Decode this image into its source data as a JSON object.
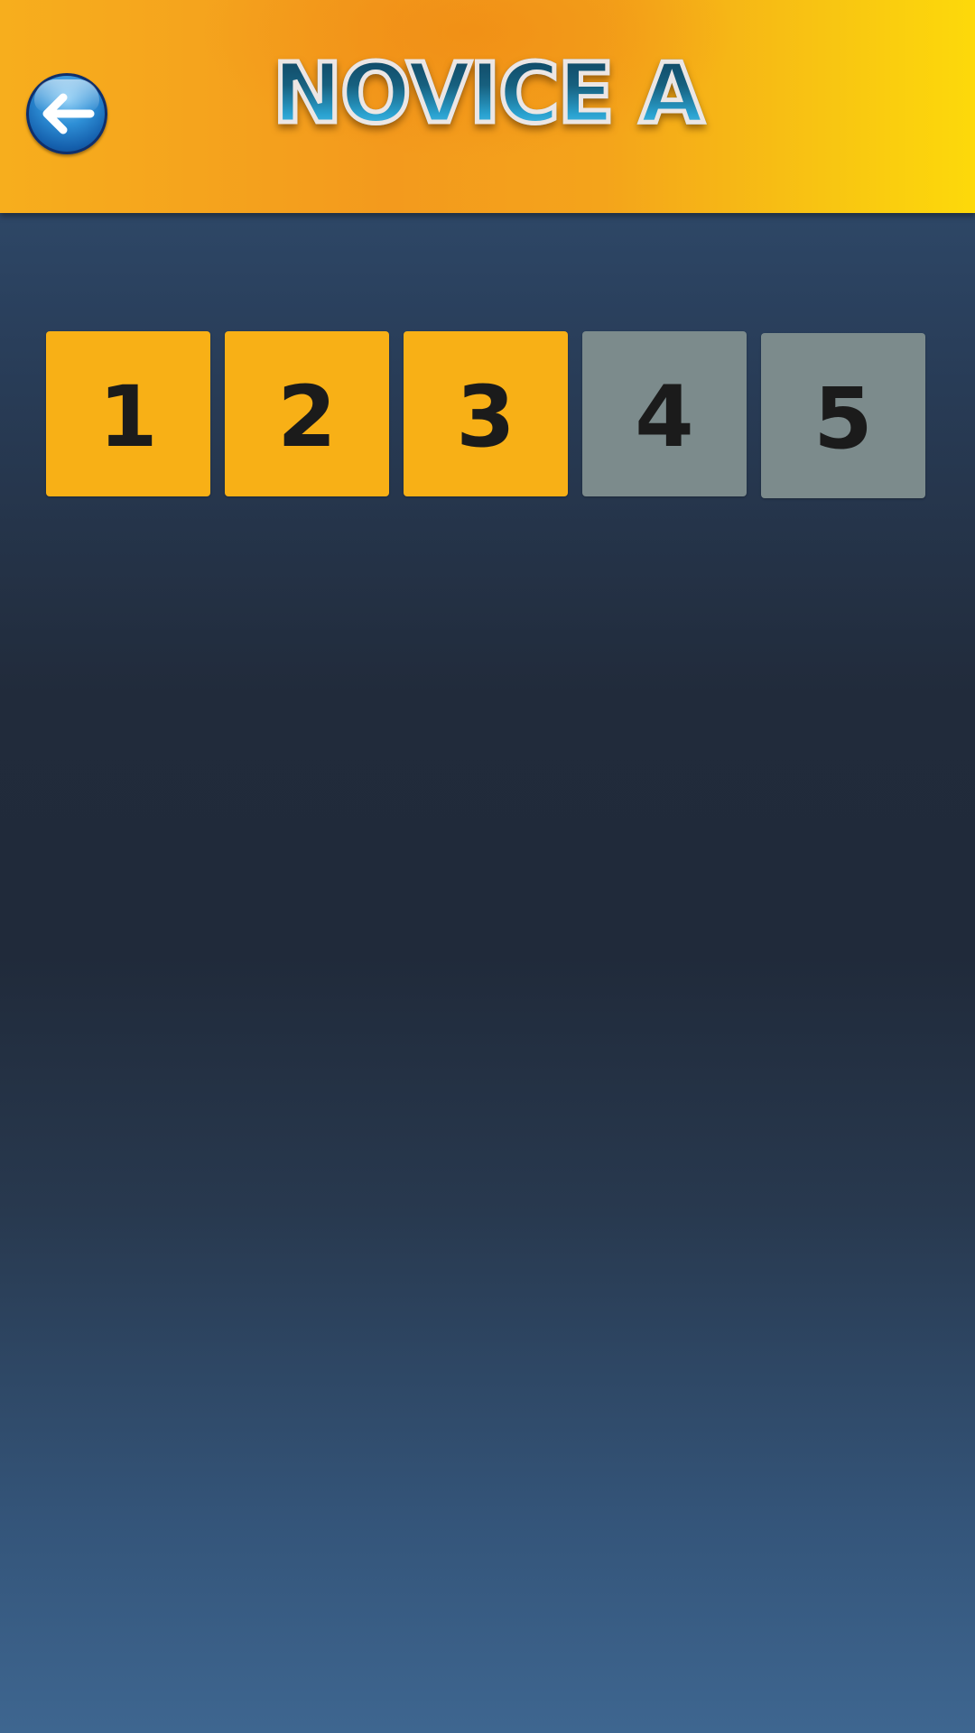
{
  "header": {
    "title": "NOVICE A",
    "back_icon": "back-arrow-icon"
  },
  "colors": {
    "unlocked_tile": "#f8b016",
    "locked_tile": "#7c8b8c",
    "header_orange": "#f39a1d",
    "header_yellow": "#fdd90a",
    "title_blue": "#2a9ac8"
  },
  "levels": [
    {
      "label": "1",
      "state": "unlocked"
    },
    {
      "label": "2",
      "state": "unlocked"
    },
    {
      "label": "3",
      "state": "unlocked"
    },
    {
      "label": "4",
      "state": "locked"
    },
    {
      "label": "5",
      "state": "locked"
    }
  ]
}
